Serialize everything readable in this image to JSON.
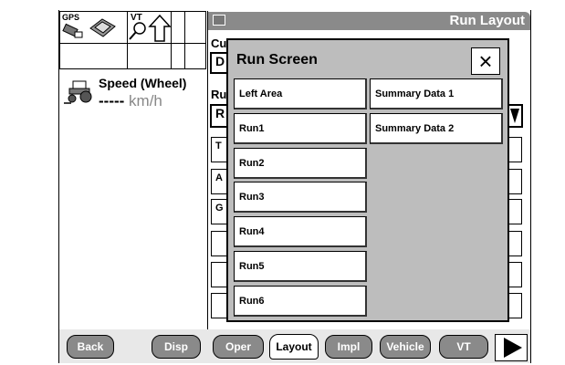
{
  "status": {
    "gps_label": "GPS",
    "vt_label": "VT"
  },
  "speed": {
    "label": "Speed (Wheel)",
    "dashes": "-----",
    "unit": "km/h"
  },
  "header": {
    "title": "Run Layout"
  },
  "underlay": {
    "cu": "Cu",
    "d": "D",
    "ru": "Ru",
    "r": "R",
    "t": "T",
    "a": "A",
    "g": "G"
  },
  "modal": {
    "title": "Run Screen",
    "close": "×",
    "left_column": [
      "Left Area",
      "Run1",
      "Run2",
      "Run3",
      "Run4",
      "Run5",
      "Run6"
    ],
    "right_column": [
      "Summary Data 1",
      "Summary Data 2"
    ]
  },
  "tabs": {
    "back": "Back",
    "disp": "Disp",
    "oper": "Oper",
    "layout": "Layout",
    "impl": "Impl",
    "vehicle": "Vehicle",
    "vt": "VT"
  },
  "colors": {
    "header_gray": "#8a8a8a",
    "modal_gray": "#bdbdbd"
  }
}
